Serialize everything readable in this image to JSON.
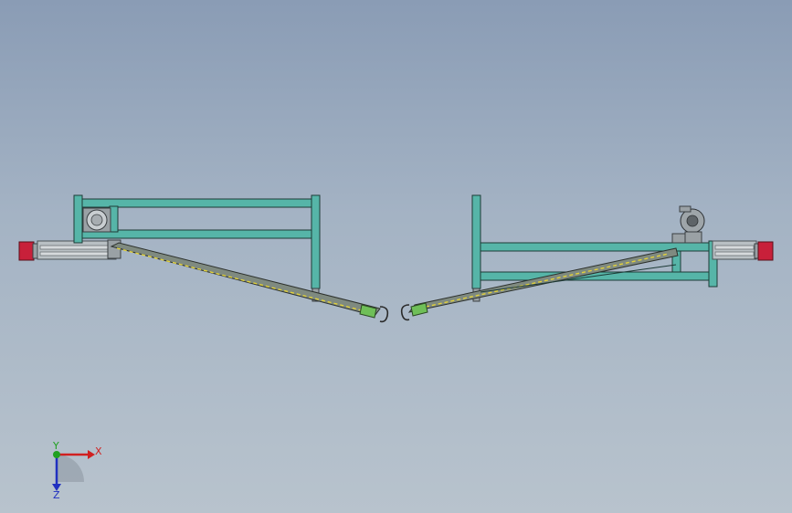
{
  "triad": {
    "x_label": "X",
    "y_label": "Y",
    "z_label": "Z",
    "colors": {
      "x": "#d02020",
      "y": "#20a020",
      "z": "#2030c0"
    }
  },
  "colors": {
    "frame": "#56b5a8",
    "end_cap": "#c8203a",
    "strut_stripe": "#e3d23a",
    "clamp": "#6fbf58",
    "background_top": "#8a9cb5",
    "background_bottom": "#b8c3cd"
  }
}
